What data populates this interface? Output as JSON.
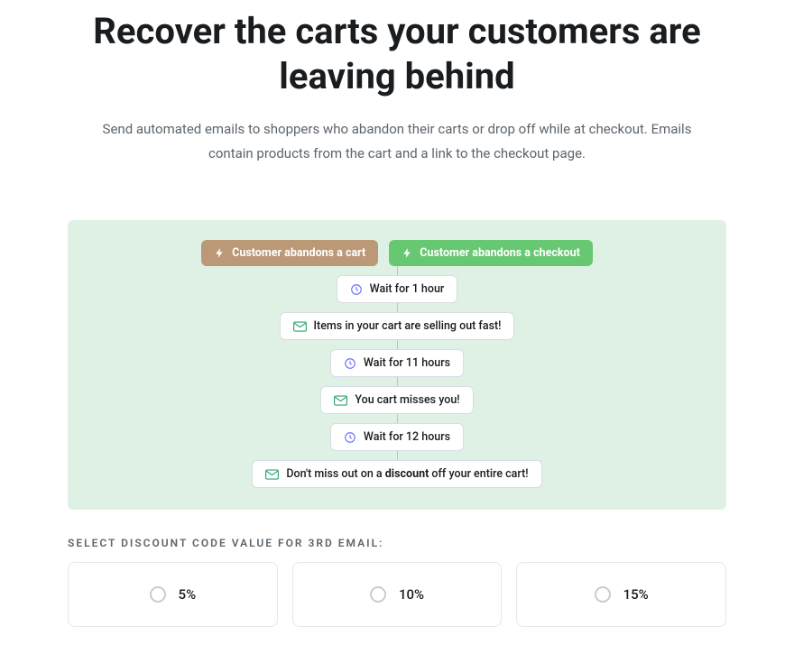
{
  "header": {
    "title": "Recover the carts your customers are leaving behind",
    "subtitle": "Send automated emails to shoppers who abandon their carts or drop off while at checkout. Emails contain products from the cart and a link to the checkout page."
  },
  "flow": {
    "triggers": [
      {
        "label": "Customer abandons a cart"
      },
      {
        "label": "Customer abandons a checkout"
      }
    ],
    "steps": [
      {
        "kind": "wait",
        "label": "Wait for 1 hour"
      },
      {
        "kind": "email",
        "label": "Items in your cart are selling out fast!"
      },
      {
        "kind": "wait",
        "label": "Wait for 11 hours"
      },
      {
        "kind": "email",
        "label": "You cart misses you!"
      },
      {
        "kind": "wait",
        "label": "Wait for 12 hours"
      },
      {
        "kind": "email",
        "prefix": "Don't miss out on a ",
        "bold": "discount",
        "suffix": " off your entire cart!"
      }
    ]
  },
  "discount": {
    "prompt": "SELECT DISCOUNT CODE VALUE FOR 3RD EMAIL:",
    "options": [
      "5%",
      "10%",
      "15%"
    ]
  }
}
